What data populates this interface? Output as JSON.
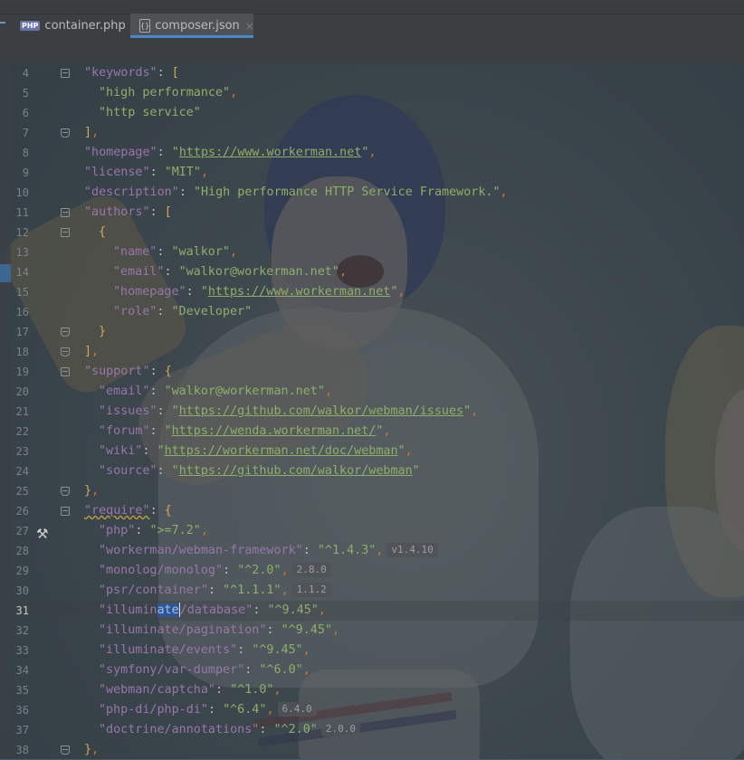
{
  "tabs": [
    {
      "icon": "php-file-icon",
      "icon_text": "PHP",
      "label": "container.php",
      "active": false
    },
    {
      "icon": "json-file-icon",
      "icon_text": "{}",
      "label": "composer.json",
      "active": true
    }
  ],
  "editor": {
    "current_line": 31,
    "lines": [
      {
        "n": "4",
        "indent": 0,
        "key": "\"keywords\"",
        "sep": ": ",
        "open": "["
      },
      {
        "n": "5",
        "indent": 1,
        "value": "\"high performance\"",
        "comma": ","
      },
      {
        "n": "6",
        "indent": 1,
        "value": "\"http service\""
      },
      {
        "n": "7",
        "indent": 0,
        "close": "]",
        "comma": ","
      },
      {
        "n": "8",
        "indent": 0,
        "key": "\"homepage\"",
        "sep": ": ",
        "q1": "\"",
        "url": "https://www.workerman.net",
        "q2": "\"",
        "comma": ","
      },
      {
        "n": "9",
        "indent": 0,
        "key": "\"license\"",
        "sep": ": ",
        "value": "\"MIT\"",
        "comma": ","
      },
      {
        "n": "10",
        "indent": 0,
        "key": "\"description\"",
        "sep": ": ",
        "value": "\"High performance HTTP Service Framework.\"",
        "comma": ","
      },
      {
        "n": "11",
        "indent": 0,
        "key": "\"authors\"",
        "sep": ": ",
        "open": "["
      },
      {
        "n": "12",
        "indent": 1,
        "open": "{"
      },
      {
        "n": "13",
        "indent": 2,
        "key": "\"name\"",
        "sep": ": ",
        "value": "\"walkor\"",
        "comma": ","
      },
      {
        "n": "14",
        "indent": 2,
        "key": "\"email\"",
        "sep": ": ",
        "value": "\"walkor@workerman.net\"",
        "comma": ","
      },
      {
        "n": "15",
        "indent": 2,
        "key": "\"homepage\"",
        "sep": ": ",
        "q1": "\"",
        "url": "https://www.workerman.net",
        "q2": "\"",
        "comma": ","
      },
      {
        "n": "16",
        "indent": 2,
        "key": "\"role\"",
        "sep": ": ",
        "value": "\"Developer\""
      },
      {
        "n": "17",
        "indent": 1,
        "close": "}"
      },
      {
        "n": "18",
        "indent": 0,
        "close": "]",
        "comma": ","
      },
      {
        "n": "19",
        "indent": 0,
        "key": "\"support\"",
        "sep": ": ",
        "open": "{"
      },
      {
        "n": "20",
        "indent": 1,
        "key": "\"email\"",
        "sep": ": ",
        "value": "\"walkor@workerman.net\"",
        "comma": ","
      },
      {
        "n": "21",
        "indent": 1,
        "key": "\"issues\"",
        "sep": ": ",
        "q1": "\"",
        "url": "https://github.com/walkor/webman/issues",
        "q2": "\"",
        "comma": ","
      },
      {
        "n": "22",
        "indent": 1,
        "key": "\"forum\"",
        "sep": ": ",
        "q1": "\"",
        "url": "https://wenda.workerman.net/",
        "q2": "\"",
        "comma": ","
      },
      {
        "n": "23",
        "indent": 1,
        "key": "\"wiki\"",
        "sep": ": ",
        "q1": "\"",
        "url": "https://workerman.net/doc/webman",
        "q2": "\"",
        "comma": ","
      },
      {
        "n": "24",
        "indent": 1,
        "key": "\"source\"",
        "sep": ": ",
        "q1": "\"",
        "url": "https://github.com/walkor/webman",
        "q2": "\""
      },
      {
        "n": "25",
        "indent": 0,
        "close": "}",
        "comma": ","
      },
      {
        "n": "26",
        "indent": 0,
        "key": "\"require\"",
        "sep": ": ",
        "open": "{"
      },
      {
        "n": "27",
        "indent": 1,
        "key": "\"php\"",
        "sep": ": ",
        "value": "\">=7.2\"",
        "comma": ","
      },
      {
        "n": "28",
        "indent": 1,
        "key": "\"workerman/webman-framework\"",
        "sep": ": ",
        "value": "\"^1.4.3\"",
        "comma": ",",
        "hint": "v1.4.10"
      },
      {
        "n": "29",
        "indent": 1,
        "key": "\"monolog/monolog\"",
        "sep": ": ",
        "value": "\"^2.0\"",
        "comma": ",",
        "hint": "2.8.0"
      },
      {
        "n": "30",
        "indent": 1,
        "key": "\"psr/container\"",
        "sep": ": ",
        "value": "\"^1.1.1\"",
        "comma": ",",
        "hint": "1.1.2"
      },
      {
        "n": "31",
        "indent": 1,
        "key_a": "\"illumin",
        "key_sel": "ate",
        "key_b": "/database\"",
        "sep": ": ",
        "value": "\"^9.45\"",
        "comma": ","
      },
      {
        "n": "32",
        "indent": 1,
        "key": "\"illuminate/pagination\"",
        "sep": ": ",
        "value": "\"^9.45\"",
        "comma": ","
      },
      {
        "n": "33",
        "indent": 1,
        "key": "\"illuminate/events\"",
        "sep": ": ",
        "value": "\"^9.45\"",
        "comma": ","
      },
      {
        "n": "34",
        "indent": 1,
        "key": "\"symfony/var-dumper\"",
        "sep": ": ",
        "value": "\"^6.0\"",
        "comma": ","
      },
      {
        "n": "35",
        "indent": 1,
        "key": "\"webman/captcha\"",
        "sep": ": ",
        "value": "\"^1.0\"",
        "comma": ","
      },
      {
        "n": "36",
        "indent": 1,
        "key": "\"php-di/php-di\"",
        "sep": ": ",
        "value": "\"^6.4\"",
        "comma": ",",
        "hint": "6.4.0"
      },
      {
        "n": "37",
        "indent": 1,
        "key": "\"doctrine/annotations\"",
        "sep": ": ",
        "value": "\"^2.0\"",
        "hint": "2.0.0"
      },
      {
        "n": "38",
        "indent": 0,
        "close": "}",
        "comma": ","
      }
    ]
  }
}
